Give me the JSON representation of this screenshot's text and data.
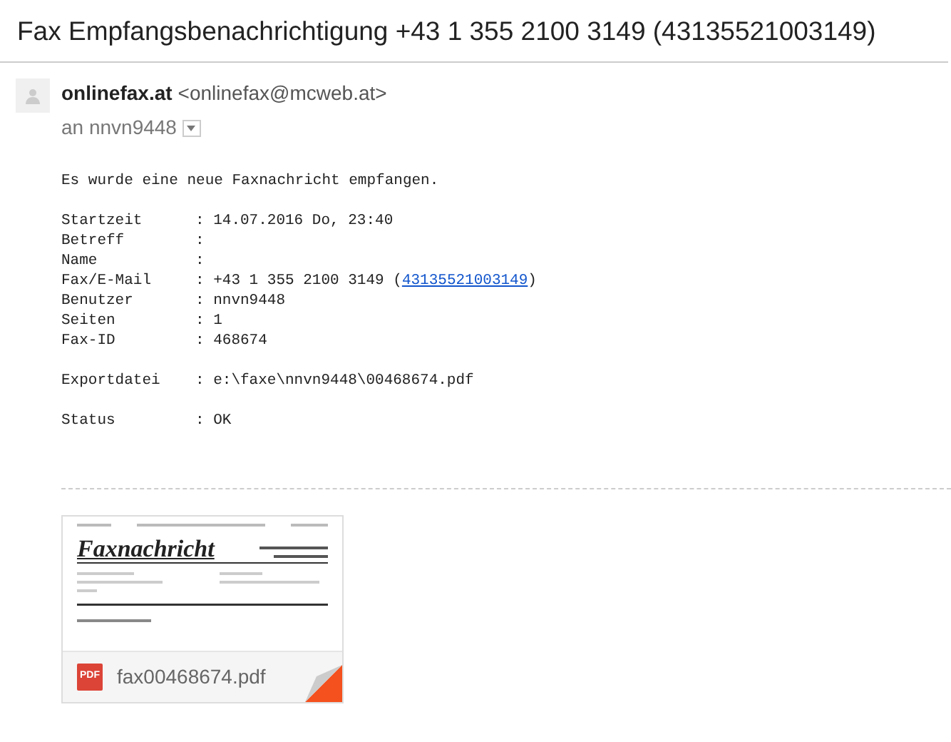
{
  "subject": "Fax Empfangsbenachrichtigung +43 1 355 2100 3149 (43135521003149)",
  "sender": {
    "name": "onlinefax.at",
    "address": "<onlinefax@mcweb.at>",
    "recipient": "an nnvn9448"
  },
  "intro": "Es wurde eine neue Faxnachricht empfangen.",
  "field_groups": [
    [
      {
        "label": "Startzeit",
        "value": ": 14.07.2016 Do, 23:40"
      },
      {
        "label": "Betreff",
        "value": ":"
      },
      {
        "label": "Name",
        "value": ":"
      },
      {
        "label": "Fax/E-Mail",
        "value": ": +43 1 355 2100 3149 (",
        "link": "43135521003149",
        "after": ")"
      },
      {
        "label": "Benutzer",
        "value": ": nnvn9448"
      },
      {
        "label": "Seiten",
        "value": ": 1"
      },
      {
        "label": "Fax-ID",
        "value": ": 468674"
      }
    ],
    [
      {
        "label": "Exportdatei",
        "value": ": e:\\faxe\\nnvn9448\\00468674.pdf"
      }
    ],
    [
      {
        "label": "Status",
        "value": ": OK"
      }
    ]
  ],
  "attachment": {
    "preview_title": "Faxnachricht",
    "file_type": "PDF",
    "filename": "fax00468674.pdf"
  }
}
